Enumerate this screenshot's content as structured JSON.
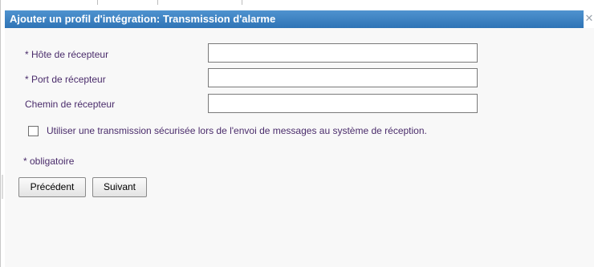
{
  "dialog": {
    "title": "Ajouter un profil d'intégration: Transmission d'alarme",
    "close_glyph": "✕"
  },
  "form": {
    "fields": [
      {
        "label": "* Hôte de récepteur",
        "value": ""
      },
      {
        "label": "* Port de récepteur",
        "value": ""
      },
      {
        "label": "Chemin de récepteur",
        "value": ""
      }
    ],
    "secure_transmission": {
      "label": "Utiliser une transmission sécurisée lors de l'envoi de messages au système de réception.",
      "checked": false
    },
    "required_note": "* obligatoire"
  },
  "buttons": {
    "previous_label": "Précédent",
    "next_label": "Suivant"
  },
  "colors": {
    "titlebar": "#3a7fc1",
    "label_text": "#4a2c6b",
    "background": "#f8f8f8"
  }
}
